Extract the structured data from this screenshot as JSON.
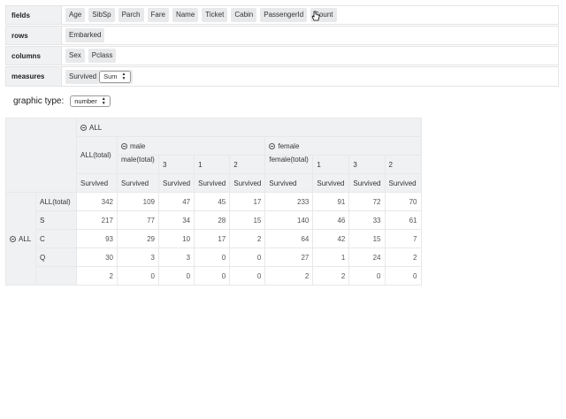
{
  "fields": {
    "label": "fields",
    "items": [
      "Age",
      "SibSp",
      "Parch",
      "Fare",
      "Name",
      "Ticket",
      "Cabin",
      "PassengerId",
      "Count"
    ]
  },
  "rows": {
    "label": "rows",
    "items": [
      "Embarked"
    ]
  },
  "columns": {
    "label": "columns",
    "items": [
      "Sex",
      "Pclass"
    ]
  },
  "measures": {
    "label": "measures",
    "item": "Survived",
    "agg": "Sum"
  },
  "graphic": {
    "label": "graphic type:",
    "value": "number"
  },
  "pivot": {
    "all_label": "ALL",
    "all_total": "ALL(total)",
    "male": "male",
    "male_total": "male(total)",
    "female": "female",
    "female_total": "female(total)",
    "male_classes": [
      "3",
      "1",
      "2"
    ],
    "female_classes": [
      "1",
      "3",
      "2"
    ],
    "measure": "Survived",
    "row_labels": [
      "ALL(total)",
      "S",
      "C",
      "Q",
      ""
    ],
    "rows": [
      [
        "342",
        "109",
        "47",
        "45",
        "17",
        "233",
        "91",
        "72",
        "70"
      ],
      [
        "217",
        "77",
        "34",
        "28",
        "15",
        "140",
        "46",
        "33",
        "61"
      ],
      [
        "93",
        "29",
        "10",
        "17",
        "2",
        "64",
        "42",
        "15",
        "7"
      ],
      [
        "30",
        "3",
        "3",
        "0",
        "0",
        "27",
        "1",
        "24",
        "2"
      ],
      [
        "2",
        "0",
        "0",
        "0",
        "0",
        "2",
        "2",
        "0",
        "0"
      ]
    ]
  }
}
